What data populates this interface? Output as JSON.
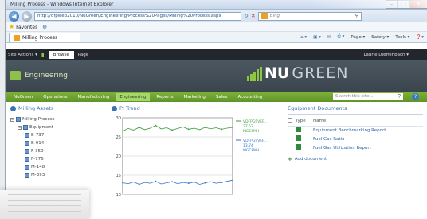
{
  "browser": {
    "title": "Milling Process - Windows Internet Explorer",
    "url": "http://dfpweb2010/NuGreen/Engineering/Process%20Pages/Milling%20Process.aspx",
    "search_placeholder": "Bing",
    "favorites_label": "Favorites",
    "tab_label": "Milling Process",
    "commands": [
      "Page ▾",
      "Safety ▾",
      "Tools ▾"
    ]
  },
  "ribbon": {
    "site_actions": "Site Actions ▾",
    "browse": "Browse",
    "page": "Page",
    "user": "Laurie Dieffenbach ▾"
  },
  "site": {
    "name": "Engineering",
    "logo_bold": "NU",
    "logo_light": "GREEN"
  },
  "nav": {
    "items": [
      "NuGreen",
      "Operations",
      "Manufacturing",
      "Engineering",
      "Reports",
      "Marketing",
      "Sales",
      "Accounting"
    ],
    "active": "Engineering",
    "search_placeholder": "Search this site..."
  },
  "assets": {
    "title": "Milling Assets",
    "tree": [
      {
        "label": "Milling Process",
        "level": 1
      },
      {
        "label": "Equipment",
        "level": 2
      },
      {
        "label": "B-737",
        "level": 3
      },
      {
        "label": "B-914",
        "level": 3
      },
      {
        "label": "F-350",
        "level": 3
      },
      {
        "label": "F-776",
        "level": 3
      },
      {
        "label": "M-148",
        "level": 3
      },
      {
        "label": "M-393",
        "level": 3
      }
    ]
  },
  "trend": {
    "title": "PI Trend",
    "legend": [
      {
        "text": "VDFPGSVER.. 27.52 MGCFMH",
        "color": "#3a9a3a"
      },
      {
        "text": "VDFPGSVER.. 13.74 MGCFMH",
        "color": "#2f75c9"
      }
    ]
  },
  "chart_data": {
    "type": "line",
    "title": "PI Trend",
    "xlabel": "",
    "ylabel": "",
    "ylim": [
      10,
      30
    ],
    "yticks": [
      30,
      25,
      20,
      15,
      10
    ],
    "grid": true,
    "series": [
      {
        "name": "VDFPGSVER.. 27.52 MGCFMH",
        "color": "#3a9a3a",
        "values": [
          26.5,
          27.2,
          26.8,
          27.5,
          26.9,
          27.3,
          28.0,
          27.1,
          27.4,
          26.8,
          27.2,
          27.6,
          27.0,
          27.3,
          26.9,
          27.5,
          27.1,
          27.4,
          27.0,
          27.3,
          27.5
        ]
      },
      {
        "name": "VDFPGSVER.. 13.74 MGCFMH",
        "color": "#2f75c9",
        "values": [
          13.0,
          12.8,
          13.2,
          12.6,
          13.1,
          12.9,
          13.4,
          12.7,
          13.0,
          13.3,
          12.8,
          13.1,
          12.9,
          13.2,
          12.6,
          13.0,
          13.3,
          12.9,
          13.1,
          13.4,
          13.7
        ]
      }
    ]
  },
  "documents": {
    "title": "Equipment Documents",
    "col_type": "Type",
    "col_name": "Name",
    "items": [
      "Equipment Benchmarking Report",
      "Fuel Gas Ratio",
      "Fuel Gas Utilization Report"
    ],
    "add_label": "Add document"
  },
  "colors": {
    "nav_green": "#6ea632",
    "header_gray": "#444e56",
    "link_blue": "#2f65a8"
  }
}
